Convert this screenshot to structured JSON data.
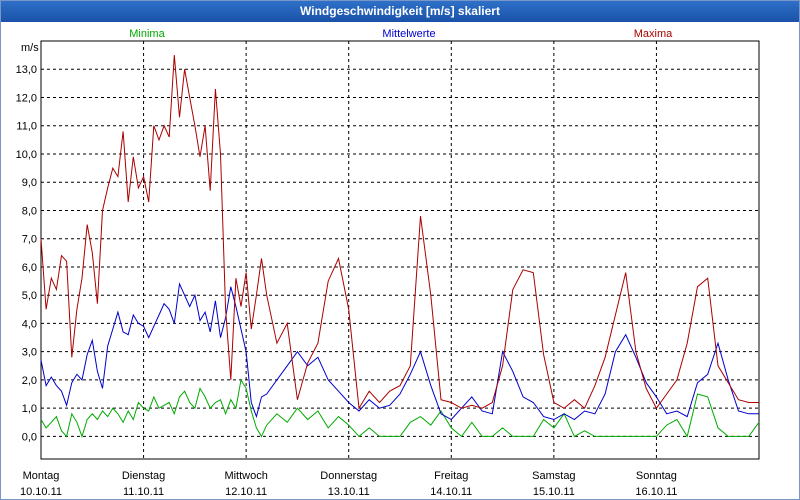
{
  "window": {
    "title": "Windgeschwindigkeit [m/s] skaliert"
  },
  "colors": {
    "minima": "#00aa00",
    "mittelwerte": "#0000cc",
    "maxima": "#aa0000",
    "grid": "#000000",
    "title_bg": "#1a52a8"
  },
  "chart_data": {
    "type": "line",
    "title": "Windgeschwindigkeit [m/s] skaliert",
    "ylabel": "m/s",
    "xlabel": "",
    "ylim": [
      -0.8,
      14.0
    ],
    "yticks": [
      "0,0",
      "1,0",
      "2,0",
      "3,0",
      "4,0",
      "5,0",
      "6,0",
      "7,0",
      "8,0",
      "9,0",
      "10,0",
      "11,0",
      "12,0",
      "13,0"
    ],
    "ytick_values": [
      0,
      1,
      2,
      3,
      4,
      5,
      6,
      7,
      8,
      9,
      10,
      11,
      12,
      13
    ],
    "x_unit": "day",
    "xlim": [
      0,
      7
    ],
    "days": [
      {
        "name": "Montag",
        "date": "10.10.11"
      },
      {
        "name": "Dienstag",
        "date": "11.10.11"
      },
      {
        "name": "Mittwoch",
        "date": "12.10.11"
      },
      {
        "name": "Donnerstag",
        "date": "13.10.11"
      },
      {
        "name": "Freitag",
        "date": "14.10.11"
      },
      {
        "name": "Samstag",
        "date": "15.10.11"
      },
      {
        "name": "Sonntag",
        "date": "16.10.11"
      }
    ],
    "grid": true,
    "legend_placement": "top",
    "series": [
      {
        "name": "Minima",
        "color": "#00aa00",
        "x": [
          0,
          0.05,
          0.1,
          0.15,
          0.2,
          0.25,
          0.3,
          0.35,
          0.4,
          0.45,
          0.5,
          0.55,
          0.6,
          0.65,
          0.7,
          0.75,
          0.8,
          0.85,
          0.9,
          0.95,
          1.0,
          1.05,
          1.1,
          1.15,
          1.2,
          1.25,
          1.3,
          1.35,
          1.4,
          1.45,
          1.5,
          1.55,
          1.6,
          1.65,
          1.7,
          1.75,
          1.8,
          1.85,
          1.9,
          1.95,
          2.0,
          2.05,
          2.1,
          2.15,
          2.2,
          2.3,
          2.4,
          2.5,
          2.6,
          2.7,
          2.8,
          2.9,
          3.0,
          3.1,
          3.2,
          3.3,
          3.4,
          3.5,
          3.6,
          3.7,
          3.8,
          3.9,
          4.0,
          4.1,
          4.2,
          4.3,
          4.4,
          4.5,
          4.6,
          4.7,
          4.8,
          4.9,
          5.0,
          5.1,
          5.2,
          5.3,
          5.4,
          5.5,
          5.6,
          5.7,
          5.8,
          5.9,
          6.0,
          6.1,
          6.2,
          6.3,
          6.4,
          6.5,
          6.6,
          6.7,
          6.8,
          6.9,
          7.0
        ],
        "y": [
          0.6,
          0.3,
          0.5,
          0.7,
          0.2,
          0.0,
          0.8,
          0.5,
          0.0,
          0.6,
          0.8,
          0.6,
          0.9,
          0.7,
          1.0,
          0.8,
          0.5,
          0.9,
          0.6,
          1.2,
          1.0,
          0.9,
          1.4,
          1.0,
          1.1,
          1.2,
          0.8,
          1.4,
          1.6,
          1.2,
          1.0,
          1.7,
          1.4,
          1.0,
          1.2,
          1.3,
          0.8,
          1.3,
          1.0,
          2.0,
          1.7,
          0.9,
          0.3,
          0.0,
          0.4,
          0.8,
          0.5,
          1.0,
          0.6,
          0.9,
          0.3,
          0.7,
          0.4,
          0.0,
          0.3,
          0.0,
          0.0,
          0.0,
          0.5,
          0.7,
          0.4,
          0.9,
          0.3,
          0.0,
          0.5,
          0.0,
          0.0,
          0.3,
          0.0,
          0.0,
          0.0,
          0.6,
          0.3,
          0.8,
          0.0,
          0.2,
          0.0,
          0.0,
          0.0,
          0.0,
          0.0,
          0.0,
          0.0,
          0.4,
          0.6,
          0.0,
          1.5,
          1.4,
          0.3,
          0.0,
          0.0,
          0.0,
          0.5
        ]
      },
      {
        "name": "Mittelwerte",
        "color": "#0000cc",
        "x": [
          0,
          0.05,
          0.1,
          0.15,
          0.2,
          0.25,
          0.3,
          0.35,
          0.4,
          0.45,
          0.5,
          0.55,
          0.6,
          0.65,
          0.7,
          0.75,
          0.8,
          0.85,
          0.9,
          0.95,
          1.0,
          1.05,
          1.1,
          1.15,
          1.2,
          1.25,
          1.3,
          1.35,
          1.4,
          1.45,
          1.5,
          1.55,
          1.6,
          1.65,
          1.7,
          1.75,
          1.8,
          1.85,
          1.9,
          1.95,
          2.0,
          2.05,
          2.1,
          2.15,
          2.2,
          2.3,
          2.4,
          2.5,
          2.6,
          2.7,
          2.8,
          2.9,
          3.0,
          3.1,
          3.2,
          3.3,
          3.4,
          3.5,
          3.6,
          3.7,
          3.8,
          3.9,
          4.0,
          4.1,
          4.2,
          4.3,
          4.4,
          4.5,
          4.6,
          4.7,
          4.8,
          4.9,
          5.0,
          5.1,
          5.2,
          5.3,
          5.4,
          5.5,
          5.6,
          5.7,
          5.8,
          5.9,
          6.0,
          6.1,
          6.2,
          6.3,
          6.4,
          6.5,
          6.6,
          6.7,
          6.8,
          6.9,
          7.0
        ],
        "y": [
          2.7,
          1.8,
          2.1,
          1.8,
          1.6,
          1.1,
          1.9,
          2.2,
          2.0,
          2.9,
          3.4,
          2.3,
          1.7,
          3.2,
          3.8,
          4.4,
          3.7,
          3.6,
          4.3,
          4.0,
          3.9,
          3.5,
          3.9,
          4.3,
          4.7,
          4.5,
          4.0,
          5.4,
          5.0,
          4.6,
          5.0,
          4.1,
          4.4,
          3.7,
          4.8,
          3.5,
          4.2,
          5.3,
          4.6,
          3.8,
          3.0,
          1.2,
          0.7,
          1.4,
          1.5,
          2.0,
          2.5,
          3.0,
          2.5,
          2.8,
          2.0,
          1.6,
          1.2,
          0.9,
          1.3,
          1.0,
          1.1,
          1.5,
          2.2,
          3.0,
          1.8,
          0.8,
          0.6,
          1.0,
          1.4,
          0.9,
          0.8,
          3.0,
          2.3,
          1.4,
          1.2,
          0.7,
          0.6,
          0.8,
          0.6,
          0.9,
          0.8,
          1.5,
          3.0,
          3.6,
          2.8,
          1.9,
          1.4,
          0.8,
          0.9,
          0.7,
          1.9,
          2.2,
          3.3,
          2.0,
          0.9,
          0.8,
          0.8
        ]
      },
      {
        "name": "Maxima",
        "color": "#aa0000",
        "x": [
          0,
          0.05,
          0.1,
          0.15,
          0.2,
          0.25,
          0.3,
          0.35,
          0.4,
          0.45,
          0.5,
          0.55,
          0.6,
          0.65,
          0.7,
          0.75,
          0.8,
          0.85,
          0.9,
          0.95,
          1.0,
          1.05,
          1.1,
          1.15,
          1.2,
          1.25,
          1.3,
          1.35,
          1.4,
          1.45,
          1.5,
          1.55,
          1.6,
          1.65,
          1.7,
          1.75,
          1.8,
          1.85,
          1.9,
          1.95,
          2.0,
          2.05,
          2.1,
          2.15,
          2.2,
          2.3,
          2.4,
          2.5,
          2.6,
          2.7,
          2.8,
          2.9,
          3.0,
          3.1,
          3.2,
          3.3,
          3.4,
          3.5,
          3.6,
          3.7,
          3.8,
          3.9,
          4.0,
          4.1,
          4.2,
          4.3,
          4.4,
          4.5,
          4.6,
          4.7,
          4.8,
          4.9,
          5.0,
          5.1,
          5.2,
          5.3,
          5.4,
          5.5,
          5.6,
          5.7,
          5.8,
          5.9,
          6.0,
          6.1,
          6.2,
          6.3,
          6.4,
          6.5,
          6.6,
          6.7,
          6.8,
          6.9,
          7.0
        ],
        "y": [
          7.0,
          4.5,
          5.6,
          5.2,
          6.4,
          6.2,
          2.8,
          4.5,
          5.6,
          7.5,
          6.5,
          4.7,
          8.0,
          8.8,
          9.5,
          9.2,
          10.8,
          8.3,
          9.9,
          8.8,
          9.2,
          8.3,
          11.0,
          10.5,
          11.0,
          10.6,
          13.5,
          11.3,
          13.0,
          12.0,
          11.0,
          9.9,
          11.0,
          8.7,
          12.3,
          10.0,
          4.5,
          2.0,
          5.6,
          4.6,
          5.8,
          3.8,
          5.0,
          6.3,
          5.0,
          3.3,
          4.0,
          1.3,
          2.6,
          3.3,
          5.5,
          6.3,
          4.5,
          1.0,
          1.6,
          1.2,
          1.6,
          1.8,
          2.5,
          7.8,
          5.0,
          1.3,
          1.2,
          1.0,
          1.1,
          1.0,
          1.2,
          2.5,
          5.2,
          5.9,
          5.8,
          2.9,
          1.2,
          1.0,
          1.3,
          1.0,
          1.8,
          2.8,
          4.3,
          5.8,
          3.0,
          1.7,
          1.0,
          1.5,
          2.0,
          3.3,
          5.3,
          5.6,
          2.5,
          1.9,
          1.3,
          1.2,
          1.2
        ]
      }
    ]
  }
}
